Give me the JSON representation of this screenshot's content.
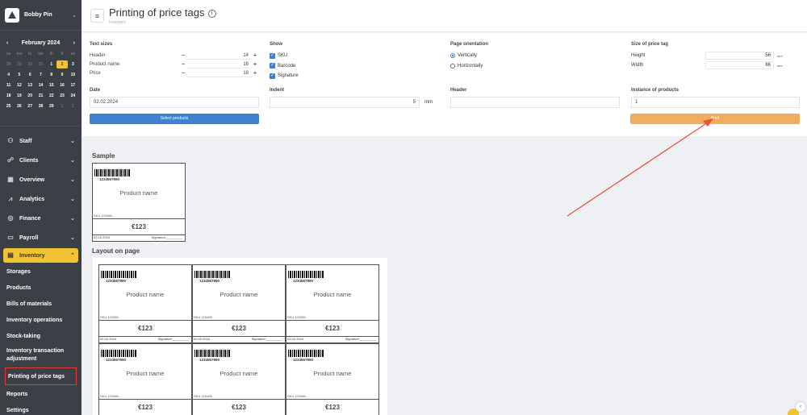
{
  "user": {
    "name": "Bobby Pin"
  },
  "calendar": {
    "month": "February 2024",
    "dow": [
      "su",
      "mo",
      "tu",
      "we",
      "th",
      "fr",
      "sa"
    ],
    "weeks": [
      [
        {
          "d": "28",
          "dim": true
        },
        {
          "d": "29",
          "dim": true
        },
        {
          "d": "30",
          "dim": true
        },
        {
          "d": "31",
          "dim": true
        },
        {
          "d": "1"
        },
        {
          "d": "2",
          "today": true
        },
        {
          "d": "3"
        }
      ],
      [
        {
          "d": "4"
        },
        {
          "d": "5"
        },
        {
          "d": "6"
        },
        {
          "d": "7"
        },
        {
          "d": "8"
        },
        {
          "d": "9"
        },
        {
          "d": "10"
        }
      ],
      [
        {
          "d": "11"
        },
        {
          "d": "12"
        },
        {
          "d": "13"
        },
        {
          "d": "14"
        },
        {
          "d": "15"
        },
        {
          "d": "16"
        },
        {
          "d": "17"
        }
      ],
      [
        {
          "d": "18"
        },
        {
          "d": "19"
        },
        {
          "d": "20"
        },
        {
          "d": "21"
        },
        {
          "d": "22"
        },
        {
          "d": "23"
        },
        {
          "d": "24"
        }
      ],
      [
        {
          "d": "25"
        },
        {
          "d": "26"
        },
        {
          "d": "27"
        },
        {
          "d": "28"
        },
        {
          "d": "29"
        },
        {
          "d": "1",
          "dim": true
        },
        {
          "d": "2",
          "dim": true
        }
      ]
    ]
  },
  "menu": [
    {
      "label": "Staff",
      "icon": "person-icon"
    },
    {
      "label": "Clients",
      "icon": "clients-icon"
    },
    {
      "label": "Overview",
      "icon": "grid-icon"
    },
    {
      "label": "Analytics",
      "icon": "chart-icon"
    },
    {
      "label": "Finance",
      "icon": "coin-icon"
    },
    {
      "label": "Payroll",
      "icon": "wallet-icon"
    }
  ],
  "inventory": {
    "label": "Inventory",
    "items": [
      "Storages",
      "Products",
      "Bills of materials",
      "Inventory operations",
      "Stock-taking",
      "Inventory transaction adjustment",
      "Printing of price tags",
      "Reports",
      "Settings"
    ],
    "active": "Printing of price tags"
  },
  "page": {
    "title": "Printing of price tags",
    "breadcrumb": "Inventory"
  },
  "text_sizes": {
    "label": "Text sizes",
    "rows": [
      {
        "name": "Header",
        "value": "14"
      },
      {
        "name": "Product name",
        "value": "16"
      },
      {
        "name": "Price",
        "value": "18"
      }
    ]
  },
  "show": {
    "label": "Show",
    "options": [
      {
        "name": "SKU",
        "checked": true
      },
      {
        "name": "Barcode",
        "checked": true
      },
      {
        "name": "Signature",
        "checked": true
      }
    ]
  },
  "orientation": {
    "label": "Page orientation",
    "options": [
      {
        "name": "Vertically",
        "selected": true
      },
      {
        "name": "Horizontally",
        "selected": false
      }
    ]
  },
  "tag_size": {
    "label": "Size of price tag",
    "rows": [
      {
        "name": "Height",
        "value": "56",
        "unit": "mm"
      },
      {
        "name": "Width",
        "value": "66",
        "unit": "mm"
      }
    ]
  },
  "date": {
    "label": "Date",
    "value": "02.02.2024"
  },
  "indent": {
    "label": "Indent",
    "value": "5",
    "unit": "mm"
  },
  "header_field": {
    "label": "Header",
    "value": ""
  },
  "instances": {
    "label": "Instance of products",
    "value": "1"
  },
  "buttons": {
    "select_products": "Select products",
    "print": "Print"
  },
  "sample": {
    "title": "Sample"
  },
  "layout": {
    "title": "Layout on page"
  },
  "price_tag": {
    "barcode": "1234567890",
    "product_name": "Product name",
    "sku": "SKU 123456",
    "price": "€123",
    "date": "02.02.2024",
    "signature": "Signature:_________"
  },
  "colors": {
    "accent": "#f1c232",
    "blue": "#3f82d3",
    "orange": "#f0ad5e",
    "sidebar": "#3b4046",
    "arrow": "#e8533a"
  }
}
